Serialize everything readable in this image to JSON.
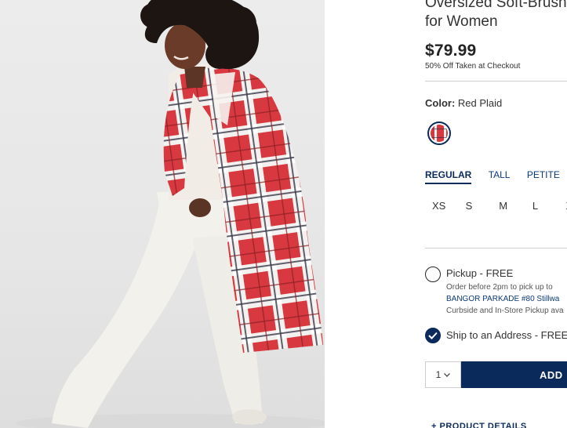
{
  "product": {
    "title_line1": "Oversized Soft-Brushed",
    "title_line2": "for Women",
    "price": "$79.99",
    "promo": "50% Off Taken at Checkout",
    "image_alt": "woman wearing red plaid oversized coat and white jeans"
  },
  "color": {
    "label": "Color:",
    "value": "Red Plaid",
    "swatch_icon": "red-plaid-swatch"
  },
  "fits": [
    {
      "label": "REGULAR",
      "active": true
    },
    {
      "label": "TALL",
      "active": false
    },
    {
      "label": "PETITE",
      "active": false
    }
  ],
  "sizes": [
    "XS",
    "S",
    "M",
    "L",
    "XL"
  ],
  "fulfillment": {
    "pickup": {
      "label": "Pickup - FREE",
      "note": "Order before 2pm to pick up to",
      "store": "BANGOR PARKADE #80 Stillwa",
      "curbside": "Curbside and In-Store Pickup ava",
      "selected": false
    },
    "ship": {
      "label": "Ship to an Address - FREE",
      "selected": true
    }
  },
  "cart": {
    "quantity": "1",
    "add_label": "ADD"
  },
  "details_label": "+ PRODUCT DETAILS",
  "colors": {
    "navy": "#0a2a5c",
    "plaid_red": "#d7373e"
  }
}
